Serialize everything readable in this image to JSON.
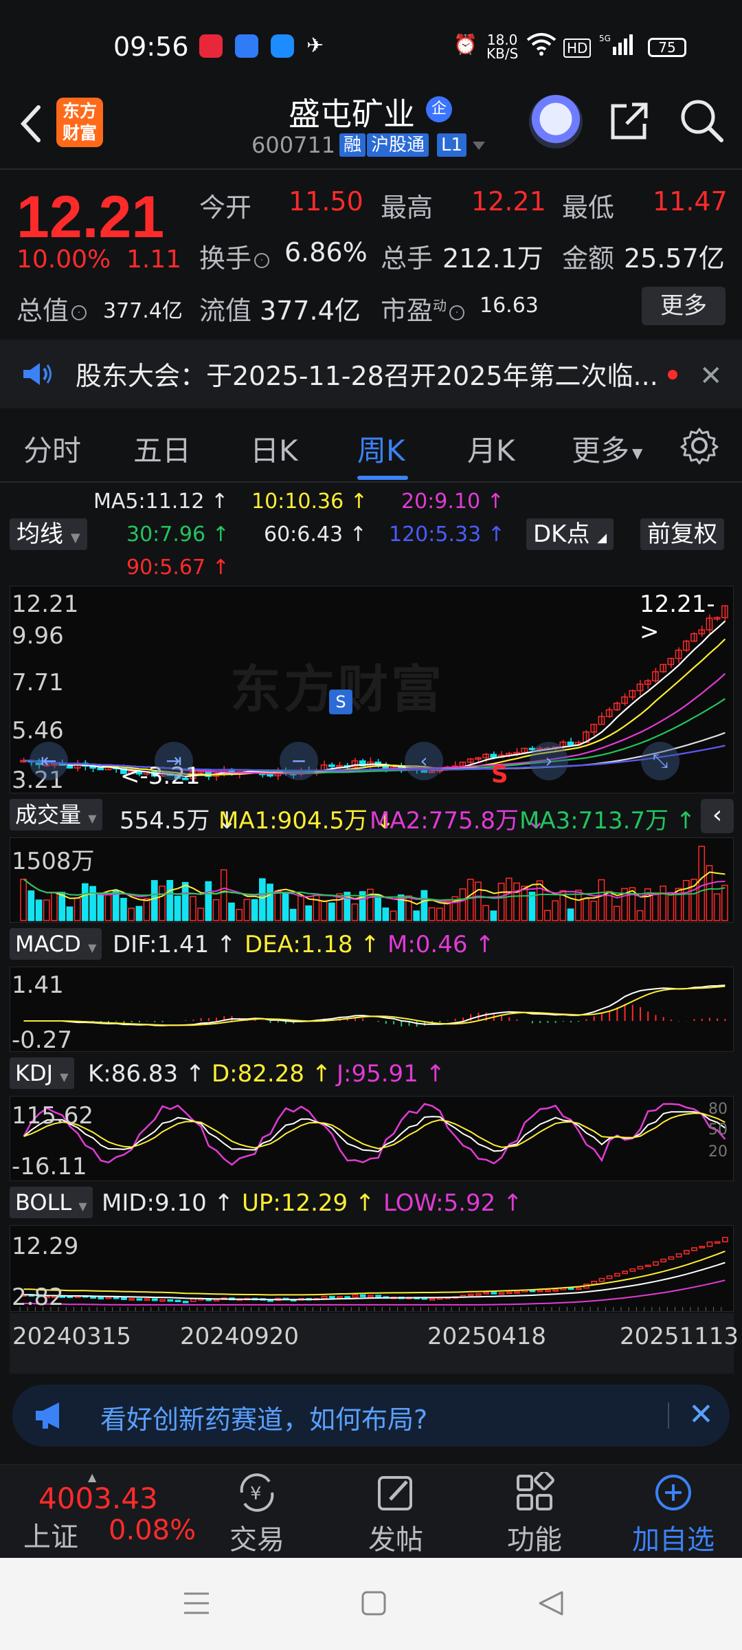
{
  "status_bar": {
    "time": "09:56",
    "net_speed_top": "18.0",
    "net_speed_bottom": "KB/S",
    "battery": "75"
  },
  "header": {
    "logo_text": "东方财富",
    "stock_name": "盛屯矿业",
    "badge": "企",
    "stock_code": "600711",
    "tags": [
      "融",
      "沪股通",
      "L1"
    ]
  },
  "quote": {
    "price": "12.21",
    "change_pct": "10.00%",
    "change": "1.11",
    "open_label": "今开",
    "open": "11.50",
    "high_label": "最高",
    "high": "12.21",
    "low_label": "最低",
    "low": "11.47",
    "turnover_label": "换手",
    "turnover": "6.86%",
    "volume_label": "总手",
    "volume": "212.1万",
    "amount_label": "金额",
    "amount": "25.57亿",
    "mktcap_label": "总值",
    "mktcap": "377.4亿",
    "float_label": "流值",
    "float": "377.4亿",
    "pe_label": "市盈",
    "pe_sup": "动",
    "pe": "16.63",
    "more": "更多"
  },
  "notice": {
    "text": "股东大会：于2025-11-28召开2025年第二次临..."
  },
  "tabs": [
    "分时",
    "五日",
    "日K",
    "周K",
    "月K",
    "更多"
  ],
  "active_tab": "周K",
  "ma_legend": {
    "ma5": "MA5:11.12",
    "ma10": "10:10.36",
    "ma20": "20:9.10",
    "ma30": "30:7.96",
    "ma60": "60:6.43",
    "ma120": "120:5.33",
    "ma90": "90:5.67",
    "chip_left": "均线",
    "chip_dk": "DK点",
    "chip_fq": "前复权",
    "arrow": "↑"
  },
  "kline": {
    "y_labels": [
      "12.21",
      "9.96",
      "7.71",
      "5.46",
      "3.21"
    ],
    "last_label": "12.21->",
    "min_label": "<-3.21",
    "watermark": "东方财富",
    "s_buy": "S",
    "s_sell": "S"
  },
  "volume": {
    "chip": "成交量",
    "value": "554.5万",
    "ma1": "MA1:904.5万",
    "ma2": "MA2:775.8万",
    "ma3": "MA3:713.7万",
    "y_label": "1508万"
  },
  "macd": {
    "chip": "MACD",
    "dif": "DIF:1.41",
    "dea": "DEA:1.18",
    "m": "M:0.46",
    "y_top": "1.41",
    "y_bottom": "-0.27"
  },
  "kdj": {
    "chip": "KDJ",
    "k": "K:86.83",
    "d": "D:82.28",
    "j": "J:95.91",
    "y_top": "115.62",
    "y_bottom": "-16.11",
    "right_labels": [
      "80",
      "50",
      "20"
    ]
  },
  "boll": {
    "chip": "BOLL",
    "mid": "MID:9.10",
    "up": "UP:12.29",
    "low": "LOW:5.92",
    "y_top": "12.29",
    "y_bottom": "2.82"
  },
  "x_dates": [
    "20240315",
    "20240920",
    "20250418",
    "20251113"
  ],
  "ad": {
    "text": "看好创新药赛道，如何布局?"
  },
  "bottom_nav": {
    "index_value": "4003.43",
    "index_name": "上证",
    "index_pct": "0.08%",
    "items": [
      "交易",
      "发帖",
      "功能",
      "加自选"
    ]
  },
  "colors": {
    "red": "#ff2b2b",
    "green": "#22c55e",
    "blue_active": "#3b82f6",
    "cyan": "#13e3f0",
    "yellow": "#ffee33",
    "magenta": "#e13bd6"
  }
}
